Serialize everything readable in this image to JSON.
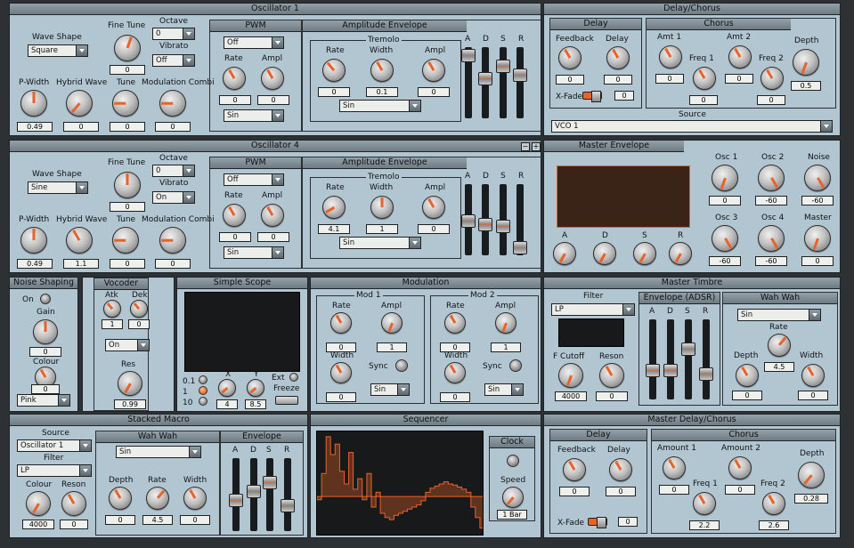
{
  "sections": {
    "osc1": "Oscillator 1",
    "delaychorus": "Delay/Chorus",
    "osc4": "Oscillator 4",
    "masterenv": "Master Envelope",
    "noise": "Noise Shaping",
    "vocoder": "Vocoder",
    "scope": "Simple Scope",
    "modulation": "Modulation",
    "timbre": "Master Timbre",
    "macro": "Stacked Macro",
    "sequencer": "Sequencer",
    "mdelay": "Master Delay/Chorus"
  },
  "osc1": {
    "wave_shape_label": "Wave Shape",
    "wave_shape": "Square",
    "fine_tune_label": "Fine Tune",
    "fine_tune": "0",
    "octave_label": "Octave",
    "octave": "0",
    "vibrato_label": "Vibrato",
    "vibrato": "Off",
    "pwidth_label": "P-Width",
    "pwidth": "0.49",
    "hybrid_label": "Hybrid Wave",
    "hybrid": "0",
    "tune_label": "Tune",
    "tune": "0",
    "modcomb_label": "Modulation Combi",
    "modcomb": "0",
    "pwm_title": "PWM",
    "pwm_mode": "Off",
    "pwm_rate_label": "Rate",
    "pwm_rate": "0",
    "pwm_ampl_label": "Ampl",
    "pwm_ampl": "0",
    "pwm_shape": "Sin",
    "ampenv_title": "Amplitude Envelope",
    "tremolo_label": "Tremolo",
    "trem_rate_label": "Rate",
    "trem_rate": "0",
    "trem_width_label": "Width",
    "trem_width": "0.1",
    "trem_ampl_label": "Ampl",
    "trem_ampl": "0",
    "trem_shape": "Sin",
    "env": [
      "A",
      "D",
      "S",
      "R"
    ]
  },
  "osc4": {
    "wave_shape": "Sine",
    "fine_tune": "0",
    "octave": "0",
    "vibrato": "On",
    "pwidth": "0.49",
    "hybrid": "1.1",
    "tune": "0",
    "modcomb": "0",
    "pwm_mode": "Off",
    "pwm_rate": "0",
    "pwm_ampl": "0",
    "pwm_shape": "Sin",
    "trem_rate": "4.1",
    "trem_width": "1",
    "trem_ampl": "0",
    "trem_shape": "Sin"
  },
  "delay": {
    "title": "Delay",
    "feedback_label": "Feedback",
    "feedback": "0",
    "delay_label": "Delay",
    "delay": "0",
    "xfade_label": "X-Fade",
    "xfade": "0"
  },
  "chorus": {
    "title": "Chorus",
    "amt1_label": "Amt 1",
    "amt1": "0",
    "amt2_label": "Amt 2",
    "amt2": "0",
    "freq1_label": "Freq 1",
    "freq1": "0",
    "freq2_label": "Freq 2",
    "freq2": "0",
    "depth_label": "Depth",
    "depth": "0.5",
    "source_label": "Source",
    "source": "VCO 1"
  },
  "masterenv": {
    "env": [
      "A",
      "D",
      "S",
      "R"
    ],
    "osc1_label": "Osc 1",
    "osc1": "0",
    "osc2_label": "Osc 2",
    "osc2": "-60",
    "noise_label": "Noise",
    "noise": "-60",
    "osc3_label": "Osc 3",
    "osc3": "-60",
    "osc4_label": "Osc 4",
    "osc4": "-60",
    "master_label": "Master",
    "master": "0"
  },
  "noise": {
    "on_label": "On",
    "gain_label": "Gain",
    "gain": "0",
    "colour_label": "Colour",
    "colour": "0",
    "type": "Pink"
  },
  "vocoder": {
    "atk_label": "Atk",
    "atk": "1",
    "dek_label": "Dek",
    "dek": "0",
    "state": "On",
    "res_label": "Res",
    "res": "0.99"
  },
  "scope": {
    "r1": "0.1",
    "r2": "1",
    "r3": "10",
    "x_label": "X",
    "x": "4",
    "y_label": "Y",
    "y": "8.5",
    "ext_label": "Ext",
    "freeze_label": "Freeze"
  },
  "mod": {
    "mod1_label": "Mod 1",
    "mod2_label": "Mod 2",
    "rate_label": "Rate",
    "ampl_label": "Ampl",
    "width_label": "Width",
    "sync_label": "Sync",
    "m1_rate": "0",
    "m1_ampl": "1",
    "m1_width": "0",
    "m1_shape": "Sin",
    "m2_rate": "0",
    "m2_ampl": "1",
    "m2_width": "0",
    "m2_shape": "Sin"
  },
  "timbre": {
    "filter_label": "Filter",
    "filter": "LP",
    "cutoff_label": "F Cutoff",
    "cutoff": "4000",
    "reson_label": "Reson",
    "reson": "0",
    "adsr_title": "Envelope (ADSR)",
    "wah_title": "Wah Wah",
    "wah_shape": "Sin",
    "wah_rate_label": "Rate",
    "wah_rate": "4.5",
    "wah_depth_label": "Depth",
    "wah_depth": "0",
    "wah_width_label": "Width",
    "wah_width": "0"
  },
  "macro": {
    "source_label": "Source",
    "source": "Oscillator 1",
    "filter_label": "Filter",
    "filter": "LP",
    "colour_label": "Colour",
    "colour": "4000",
    "reson_label": "Reson",
    "reson": "0",
    "wah_title": "Wah Wah",
    "wah_shape": "Sin",
    "depth_label": "Depth",
    "depth": "0",
    "rate_label": "Rate",
    "rate": "4.5",
    "width_label": "Width",
    "width": "0",
    "env_title": "Envelope"
  },
  "sequencer": {
    "clock_title": "Clock",
    "speed_label": "Speed",
    "speed": "1 Bar",
    "steps": [
      0.35,
      0.6,
      0.95,
      0.78,
      0.88,
      0.62,
      0.5,
      0.8,
      0.45,
      0.55,
      0.35,
      0.6,
      0.28,
      0.42,
      0.22,
      0.18,
      0.16,
      0.2,
      0.22,
      0.24,
      0.26,
      0.28,
      0.3,
      0.34,
      0.42,
      0.46,
      0.48,
      0.5,
      0.52,
      0.5,
      0.49,
      0.47,
      0.45,
      0.42,
      0.28,
      0.18,
      0.08
    ]
  },
  "mdelay": {
    "delay_title": "Delay",
    "feedback_label": "Feedback",
    "feedback": "0",
    "delay_label": "Delay",
    "delay": "0",
    "xfade_label": "X-Fade",
    "xfade": "0",
    "chorus_title": "Chorus",
    "amount1_label": "Amount 1",
    "amount1": "0",
    "amount2_label": "Amount 2",
    "amount2": "0",
    "freq1_label": "Freq 1",
    "freq1": "2.2",
    "freq2_label": "Freq 2",
    "freq2": "2.6",
    "depth_label": "Depth",
    "depth": "0.28"
  },
  "colors": {
    "panel": "#b2c6d2",
    "accent": "#e8632a",
    "background": "#2e3134"
  }
}
